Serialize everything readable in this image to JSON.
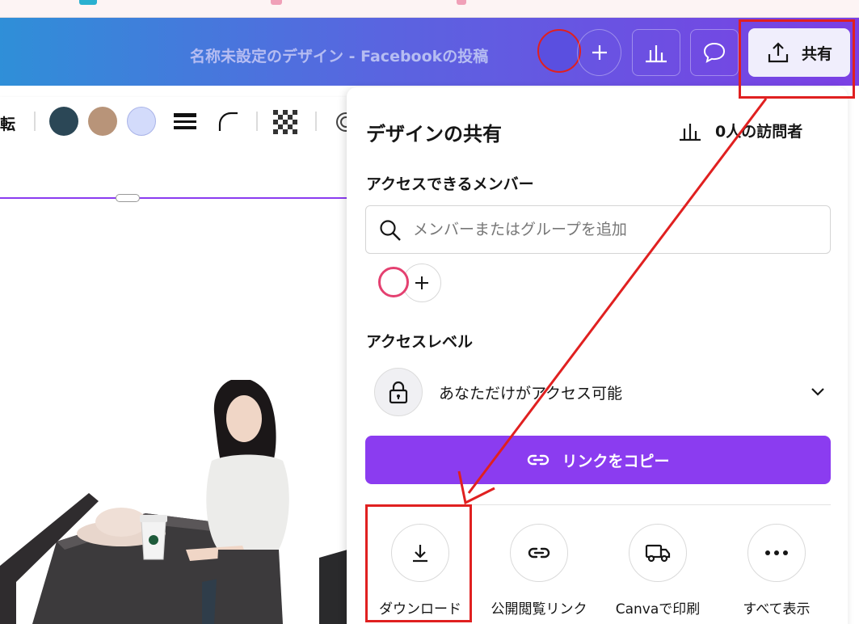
{
  "header": {
    "doc_title": "名称未設定のデザイン - Facebookの投稿",
    "share_label": "共有"
  },
  "toolbar": {
    "partial_label": "転",
    "swatches": [
      "#2b4756",
      "#b89479",
      "#d3dbfb"
    ]
  },
  "share_panel": {
    "title": "デザインの共有",
    "visitors": "0人の訪問者",
    "members_label": "アクセスできるメンバー",
    "search_placeholder": "メンバーまたはグループを追加",
    "access_level_label": "アクセスレベル",
    "access_value": "あなただけがアクセス可能",
    "copy_link_label": "リンクをコピー",
    "options": [
      {
        "label": "ダウンロード",
        "icon": "download-icon"
      },
      {
        "label": "公開閲覧リンク",
        "icon": "link-icon"
      },
      {
        "label": "Canvaで印刷",
        "icon": "truck-icon"
      },
      {
        "label": "すべて表示",
        "icon": "more-icon"
      }
    ]
  },
  "colors": {
    "accent": "#8b3cf0",
    "annotation": "#e02020"
  }
}
